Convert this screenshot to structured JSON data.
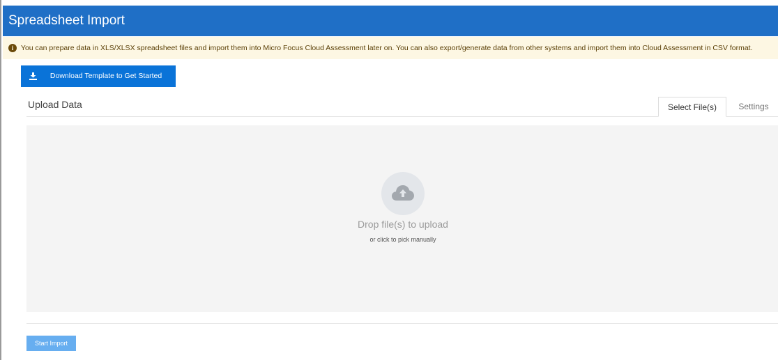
{
  "header": {
    "title": "Spreadsheet Import"
  },
  "notice": {
    "icon": "info-circle-icon",
    "text": "You can prepare data in XLS/XLSX spreadsheet files and import them into Micro Focus Cloud Assessment later on. You can also export/generate data from other systems and import them into Cloud Assessment in CSV format."
  },
  "download": {
    "label": "Download Template to Get Started",
    "icon": "download-icon"
  },
  "upload": {
    "title": "Upload Data",
    "tabs": [
      {
        "label": "Select File(s)",
        "active": true
      },
      {
        "label": "Settings",
        "active": false
      }
    ]
  },
  "dropzone": {
    "icon": "cloud-upload-icon",
    "title": "Drop file(s) to upload",
    "subtitle": "or click to pick manually"
  },
  "actions": {
    "start_label": "Start Import"
  },
  "colors": {
    "header_bg": "#1f6fc6",
    "notice_bg": "#fdf7e3",
    "primary_button": "#0a73d8",
    "disabled_button": "#67aef0",
    "dropzone_bg": "#f4f4f4"
  }
}
